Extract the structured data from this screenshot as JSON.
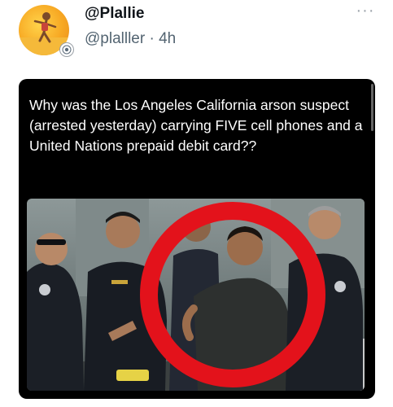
{
  "post": {
    "display_name": "@Plallie",
    "handle_and_time": "@plalller · 4h",
    "more_label": "···",
    "image_text": "Why was the Los Angeles California arson suspect  (arrested yesterday) carrying FIVE cell phones and a United Nations prepaid debit card??"
  },
  "colors": {
    "card_background": "#000000",
    "highlight_ring": "#e3121b",
    "handle_grey": "#536471"
  },
  "icons": {
    "badge": "verified-seal-icon",
    "more": "more-options-icon"
  }
}
